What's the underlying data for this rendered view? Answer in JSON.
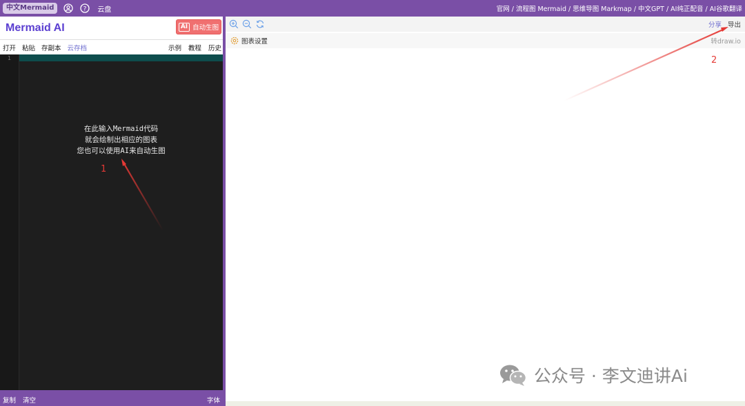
{
  "topbar": {
    "brand": "中文Mermaid",
    "cloud": "云盘",
    "links": [
      "官网 /",
      "流程图 Mermaid /",
      "思维导图 Markmap /",
      "中文GPT /",
      "AI纯正配音 /",
      "AI谷歌翻译"
    ]
  },
  "left": {
    "title": "Mermaid AI",
    "ai_badge": "AI",
    "ai_button_label": "自动生图",
    "toolbar": {
      "open": "打开",
      "paste": "粘贴",
      "save_copy": "存副本",
      "cloud_save": "云存档",
      "examples": "示例",
      "tutorial": "教程",
      "history": "历史"
    },
    "editor": {
      "line_number": "1",
      "placeholder_line1": "在此输入Mermaid代码",
      "placeholder_line2": "就会绘制出相应的图表",
      "placeholder_line3": "您也可以使用AI来自动生图"
    },
    "bottombar": {
      "copy": "复制",
      "clear": "清空",
      "font": "字体"
    }
  },
  "right": {
    "share": "分享",
    "export": "导出",
    "settings": "图表设置",
    "drawio": "转draw.io"
  },
  "annotations": {
    "one": "1",
    "two": "2"
  },
  "watermark": {
    "text": "公众号 · 李文迪讲Ai"
  },
  "colors": {
    "accent": "#7a4fa6",
    "ai_button": "#f07070",
    "annotation": "#e53935",
    "editor_bg": "#1e1e1e"
  }
}
